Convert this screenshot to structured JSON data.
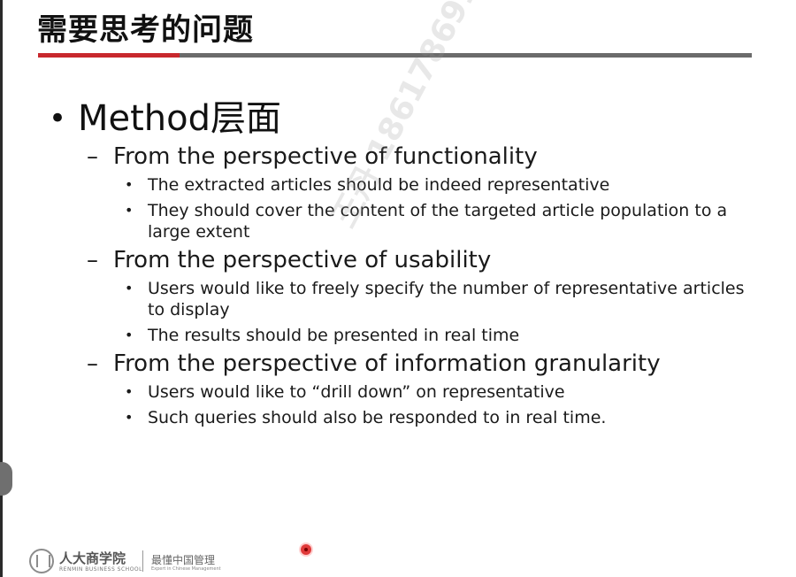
{
  "slide": {
    "title": "需要思考的问题",
    "colors": {
      "accent_red": "#c8282d",
      "rule_gray": "#6b6b6b"
    },
    "heading": {
      "bullet": "•",
      "text": "Method层面"
    },
    "sections": [
      {
        "dash": "–",
        "title": "From the perspective of functionality",
        "points": [
          {
            "lines": [
              "The extracted articles should be indeed representative"
            ]
          },
          {
            "lines": [
              "They should cover the content of the targeted article population to a",
              "large extent"
            ]
          }
        ]
      },
      {
        "dash": "–",
        "title": "From the perspective of usability",
        "points": [
          {
            "lines": [
              "Users would like to freely specify the number of representative articles",
              "to display"
            ]
          },
          {
            "lines": [
              "The results should be presented in real time"
            ]
          }
        ]
      },
      {
        "dash": "–",
        "title": "From the perspective of information granularity",
        "points": [
          {
            "lines": [
              "Users would like to “drill down” on representative"
            ]
          },
          {
            "lines": [
              "Such queries should also be responded to in real time."
            ]
          }
        ]
      }
    ],
    "bullet_dot": "•"
  },
  "watermark": "王丹 18617869168",
  "footer": {
    "school_name": "人大商学院",
    "school_name_en": "RENMIN BUSINESS SCHOOL",
    "slogan": "最懂中国管理",
    "slogan_en": "Expert in Chinese Management"
  }
}
